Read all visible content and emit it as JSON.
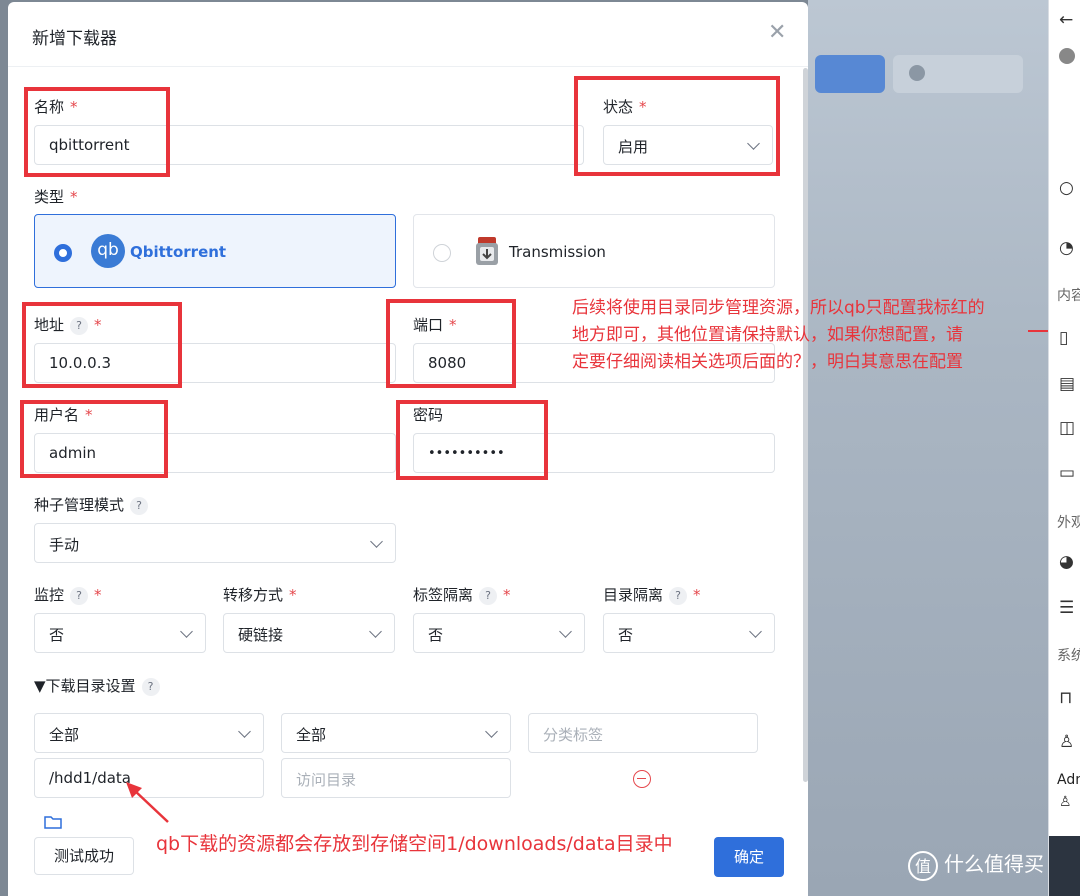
{
  "modal": {
    "title": "新增下载器",
    "close_icon": "close-icon"
  },
  "form": {
    "name_label": "名称",
    "name_value": "qbittorrent",
    "status_label": "状态",
    "status_value": "启用",
    "type_label": "类型",
    "types": [
      {
        "label": "Qbittorrent",
        "logo": "qb",
        "selected": true
      },
      {
        "label": "Transmission",
        "logo": "transmission-icon",
        "selected": false
      }
    ],
    "address_label": "地址",
    "address_value": "10.0.0.3",
    "port_label": "端口",
    "port_value": "8080",
    "username_label": "用户名",
    "username_value": "admin",
    "password_label": "密码",
    "password_value": "••••••••••",
    "seed_mode_label": "种子管理模式",
    "seed_mode_value": "手动",
    "monitor_label": "监控",
    "monitor_value": "否",
    "transfer_label": "转移方式",
    "transfer_value": "硬链接",
    "tag_isolation_label": "标签隔离",
    "tag_isolation_value": "否",
    "dir_isolation_label": "目录隔离",
    "dir_isolation_value": "否",
    "download_dir_section": "▼下载目录设置",
    "dir_row": {
      "media_type": "全部",
      "category": "全部",
      "category_tag_placeholder": "分类标签",
      "save_path": "/hdd1/data",
      "access_dir_placeholder": "访问目录"
    },
    "required_mark": "*",
    "help_mark": "?"
  },
  "buttons": {
    "test": "测试成功",
    "confirm": "确定"
  },
  "annotations": {
    "note_line1": "后续将使用目录同步管理资源，所以qb只配置我标红的",
    "note_line2": "地方即可，其他位置请保持默认，如果你想配置，请",
    "note_line3": "定要仔细阅读相关选项后面的？，明白其意思在配置",
    "bottom_note": "qb下载的资源都会存放到存储空间1/downloads/data目录中"
  },
  "side": {
    "texts": [
      "内容",
      "外观",
      "系统",
      "Adm"
    ]
  },
  "watermark": {
    "logo": "值",
    "text": "什么值得买"
  },
  "colors": {
    "accent": "#2f6fdb",
    "annotation_red": "#e8343b",
    "required_red": "#e5484d"
  }
}
